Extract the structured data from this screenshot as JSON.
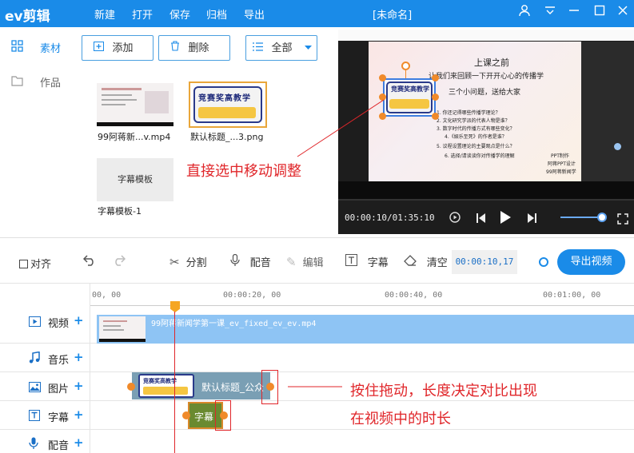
{
  "app": {
    "logo": "ev剪辑",
    "logo_mark": "ev",
    "menu": [
      "新建",
      "打开",
      "保存",
      "归档",
      "导出"
    ],
    "doc_title": "[未命名]"
  },
  "sidebar": {
    "items": [
      {
        "label": "素材",
        "icon": "grid-icon",
        "active": true
      },
      {
        "label": "作品",
        "icon": "folder-icon",
        "active": false
      }
    ]
  },
  "media_toolbar": {
    "add_label": "添加",
    "delete_label": "删除",
    "filter_value": "全部"
  },
  "media_items": [
    {
      "caption": "99阿蒋新...v.mp4"
    },
    {
      "caption": "默认标题_...3.png"
    },
    {
      "caption": "字幕模板-1",
      "thumb_text": "字幕模板"
    }
  ],
  "preview": {
    "slide_lines": [
      "上课之前",
      "让我们来回顾一下开开心心的传播学",
      "三个小问题，送给大家",
      "1. 你还记得哪些传播学理论？",
      "2. 文化研究学派的代表人物是谁？",
      "3. 数字时代的传播方式有哪些变化？",
      "4.《娱乐至死》的作者是谁？",
      "5. 议程设置理论的主要观点是什么？",
      "6. 选择/请谈谈你对传播学的理解"
    ],
    "slide_corner": [
      "PPT制作",
      "阿蒋PPT设计",
      "99阿蒋新闻学"
    ],
    "sticker_text": "竞赛奖高教学",
    "current_time": "00:00:10",
    "total_time": "01:35:10",
    "volume_fraction": 0.92
  },
  "timeline_toolbar": {
    "align_label": "对齐",
    "split_label": "分割",
    "dub_label": "配音",
    "edit_label": "编辑",
    "subtitle_label": "字幕",
    "clear_label": "清空",
    "timecode": "00:00:10,17",
    "export_label": "导出视频"
  },
  "ruler": {
    "ticks": [
      "00, 00",
      "00:00:20, 00",
      "00:00:40, 00",
      "00:01:00, 00"
    ]
  },
  "tracks": [
    {
      "label": "视频",
      "icon": "video-icon"
    },
    {
      "label": "音乐",
      "icon": "music-icon"
    },
    {
      "label": "图片",
      "icon": "image-icon"
    },
    {
      "label": "字幕",
      "icon": "text-icon"
    },
    {
      "label": "配音",
      "icon": "mic-icon"
    }
  ],
  "clips": {
    "video_clip": "99阿蒋新闻学第一课_ev_fixed_ev_ev.mp4",
    "image_clip": "默认标题_公众",
    "subtitle_clip": "字幕"
  },
  "annotations": {
    "preview_note": "直接选中移动调整",
    "timeline_note_line1": "按住拖动，长度决定对比出现",
    "timeline_note_line2": "在视频中的时长"
  },
  "colors": {
    "brand": "#1a8be8",
    "annotation": "#e0262a",
    "clip_video": "#8ec4f4",
    "clip_image": "#7a9fb4",
    "clip_subtitle": "#6a8a30",
    "handle": "#f08a2a"
  }
}
